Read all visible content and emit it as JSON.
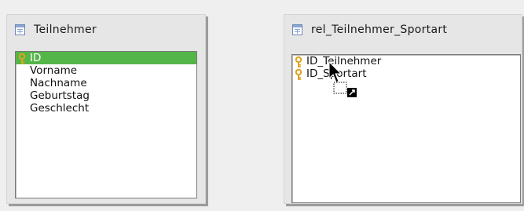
{
  "tables": [
    {
      "title": "Teilnehmer",
      "fields": [
        {
          "name": "ID",
          "primary_key": true,
          "selected": true
        },
        {
          "name": "Vorname",
          "primary_key": false,
          "selected": false
        },
        {
          "name": "Nachname",
          "primary_key": false,
          "selected": false
        },
        {
          "name": "Geburtstag",
          "primary_key": false,
          "selected": false
        },
        {
          "name": "Geschlecht",
          "primary_key": false,
          "selected": false
        }
      ]
    },
    {
      "title": "rel_Teilnehmer_Sportart",
      "fields": [
        {
          "name": "ID_Teilnehmer",
          "primary_key": true,
          "selected": false
        },
        {
          "name": "ID_Sportart",
          "primary_key": true,
          "selected": false
        }
      ]
    }
  ],
  "colors": {
    "selection": "#54b648",
    "key": "#e0a21c",
    "window_bg": "#e6e6e6"
  },
  "icons": {
    "table": "table-icon",
    "key": "key-icon",
    "cursor": "drag-link-cursor-icon"
  }
}
